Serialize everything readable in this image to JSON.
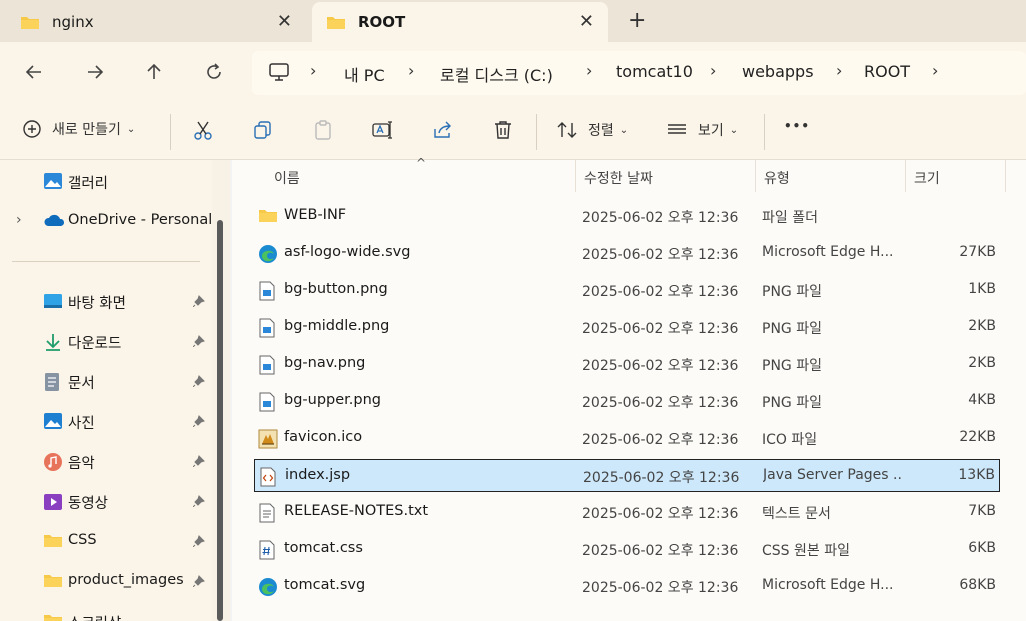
{
  "tabs": [
    {
      "label": "nginx",
      "active": false
    },
    {
      "label": "ROOT",
      "active": true
    }
  ],
  "newtab_glyph": "+",
  "close_glyph": "✕",
  "breadcrumb": [
    "내 PC",
    "로컬 디스크 (C:)",
    "tomcat10",
    "webapps",
    "ROOT"
  ],
  "toolbar": {
    "new_label": "새로 만들기",
    "sort_label": "정렬",
    "view_label": "보기",
    "more_label": "•••"
  },
  "sidebar": {
    "top_items": [
      {
        "label": "갤러리",
        "icon": "gallery-icon"
      },
      {
        "label": "OneDrive - Personal",
        "icon": "onedrive-icon"
      }
    ],
    "quick_items": [
      {
        "label": "바탕 화면",
        "icon": "desktop-icon"
      },
      {
        "label": "다운로드",
        "icon": "download-icon"
      },
      {
        "label": "문서",
        "icon": "document-icon"
      },
      {
        "label": "사진",
        "icon": "pictures-icon"
      },
      {
        "label": "음악",
        "icon": "music-icon"
      },
      {
        "label": "동영상",
        "icon": "video-icon"
      },
      {
        "label": "CSS",
        "icon": "folder-icon"
      },
      {
        "label": "product_images",
        "icon": "folder-icon"
      },
      {
        "label": "스크린샷",
        "icon": "folder-icon"
      }
    ]
  },
  "columns": {
    "name": "이름",
    "date": "수정한 날짜",
    "type": "유형",
    "size": "크기"
  },
  "files": [
    {
      "name": "WEB-INF",
      "date": "2025-06-02 오후 12:36",
      "type": "파일 폴더",
      "size": "",
      "icon": "folder-icon"
    },
    {
      "name": "asf-logo-wide.svg",
      "date": "2025-06-02 오후 12:36",
      "type": "Microsoft Edge H...",
      "size": "27KB",
      "icon": "edge-icon"
    },
    {
      "name": "bg-button.png",
      "date": "2025-06-02 오후 12:36",
      "type": "PNG 파일",
      "size": "1KB",
      "icon": "image-file-icon"
    },
    {
      "name": "bg-middle.png",
      "date": "2025-06-02 오후 12:36",
      "type": "PNG 파일",
      "size": "2KB",
      "icon": "image-file-icon"
    },
    {
      "name": "bg-nav.png",
      "date": "2025-06-02 오후 12:36",
      "type": "PNG 파일",
      "size": "2KB",
      "icon": "image-file-icon"
    },
    {
      "name": "bg-upper.png",
      "date": "2025-06-02 오후 12:36",
      "type": "PNG 파일",
      "size": "4KB",
      "icon": "image-file-icon"
    },
    {
      "name": "favicon.ico",
      "date": "2025-06-02 오후 12:36",
      "type": "ICO 파일",
      "size": "22KB",
      "icon": "tomcat-favicon-icon"
    },
    {
      "name": "index.jsp",
      "date": "2025-06-02 오후 12:36",
      "type": "Java Server Pages ...",
      "size": "13KB",
      "icon": "code-file-icon",
      "selected": true
    },
    {
      "name": "RELEASE-NOTES.txt",
      "date": "2025-06-02 오후 12:36",
      "type": "텍스트 문서",
      "size": "7KB",
      "icon": "text-file-icon"
    },
    {
      "name": "tomcat.css",
      "date": "2025-06-02 오후 12:36",
      "type": "CSS 원본 파일",
      "size": "6KB",
      "icon": "css-file-icon"
    },
    {
      "name": "tomcat.svg",
      "date": "2025-06-02 오후 12:36",
      "type": "Microsoft Edge H...",
      "size": "68KB",
      "icon": "edge-icon"
    }
  ],
  "colors": {
    "accent": "#cde8fb",
    "folder": "#f7c948",
    "tabbar": "#ece4d6",
    "chrome": "#fbf4e8"
  }
}
